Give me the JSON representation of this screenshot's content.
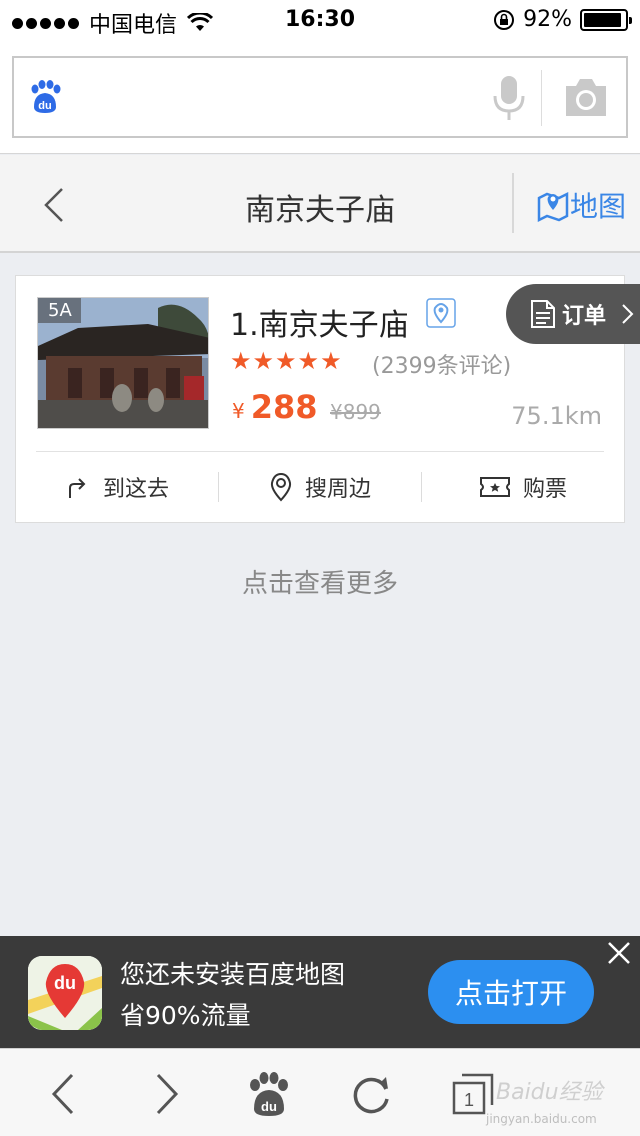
{
  "status_bar": {
    "carrier": "中国电信",
    "time": "16:30",
    "battery": "92%",
    "battery_level": 0.92
  },
  "search": {
    "value": "",
    "placeholder": ""
  },
  "header": {
    "title": "南京夫子庙",
    "map_label": "地图"
  },
  "order_tab": {
    "label": "订单"
  },
  "result": {
    "thumb_tag": "5A",
    "name": "1.南京夫子庙",
    "rating": 5,
    "reviews": "(2399条评论)",
    "currency": "¥",
    "price": "288",
    "original_price": "¥899",
    "distance": "75.1km",
    "actions": {
      "go": "到这去",
      "nearby": "搜周边",
      "ticket": "购票"
    }
  },
  "more_label": "点击查看更多",
  "banner": {
    "line1": "您还未安装百度地图",
    "line2": "省90%流量",
    "button": "点击打开",
    "icon_text": "du"
  },
  "toolbar": {
    "tabs_count": "1"
  },
  "watermark": {
    "text": "Baidu经验",
    "sub": "jingyan.baidu.com"
  },
  "colors": {
    "accent_blue": "#3a86e6",
    "star_orange": "#f05a28",
    "banner_button": "#2c8ff0"
  }
}
